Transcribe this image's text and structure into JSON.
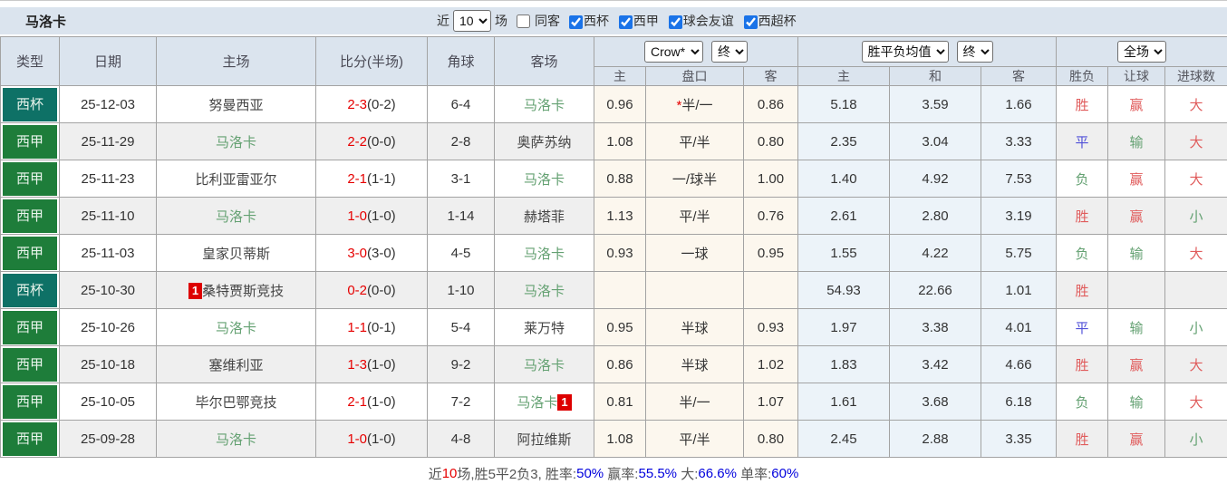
{
  "title": "马洛卡",
  "topbar": {
    "near_label": "近",
    "recent_count": "10",
    "matches_label": "场",
    "same_away": {
      "label": "同客",
      "checked": false
    },
    "filters": [
      {
        "label": "西杯",
        "checked": true
      },
      {
        "label": "西甲",
        "checked": true
      },
      {
        "label": "球会友谊",
        "checked": true
      },
      {
        "label": "西超杯",
        "checked": true
      }
    ]
  },
  "header": {
    "type": "类型",
    "date": "日期",
    "home": "主场",
    "score": "比分(半场)",
    "corner": "角球",
    "away": "客场",
    "odds_source_select": "Crow*",
    "odds_final_select": "终",
    "europe_avg_select": "胜平负均值",
    "europe_final_select": "终",
    "scope_select": "全场",
    "sub": {
      "h_home": "主",
      "h_line": "盘口",
      "h_away": "客",
      "e_win": "主",
      "e_draw": "和",
      "e_lose": "客",
      "r_result": "胜负",
      "r_handicap": "让球",
      "r_goals": "进球数"
    }
  },
  "rows": [
    {
      "type": "西杯",
      "type_color": "cup_badge",
      "date": "25-12-03",
      "home": "努曼西亚",
      "home_badge": "",
      "score": "2-3",
      "half": "(0-2)",
      "corner": "6-4",
      "away": "马洛卡",
      "away_badge": "",
      "star": "*",
      "odds_home": "0.96",
      "handicap": "半/一",
      "odds_away": "0.86",
      "win": "5.18",
      "draw": "3.59",
      "lose": "1.66",
      "result": "胜",
      "handicap_result": "赢",
      "goals_result": "大"
    },
    {
      "type": "西甲",
      "type_color": "league_badge",
      "date": "25-11-29",
      "home": "马洛卡",
      "home_badge": "",
      "score": "2-2",
      "half": "(0-0)",
      "corner": "2-8",
      "away": "奥萨苏纳",
      "away_badge": "",
      "star": "",
      "odds_home": "1.08",
      "handicap": "平/半",
      "odds_away": "0.80",
      "win": "2.35",
      "draw": "3.04",
      "lose": "3.33",
      "result": "平",
      "handicap_result": "输",
      "goals_result": "大"
    },
    {
      "type": "西甲",
      "type_color": "league_badge",
      "date": "25-11-23",
      "home": "比利亚雷亚尔",
      "home_badge": "",
      "score": "2-1",
      "half": "(1-1)",
      "corner": "3-1",
      "away": "马洛卡",
      "away_badge": "",
      "star": "",
      "odds_home": "0.88",
      "handicap": "一/球半",
      "odds_away": "1.00",
      "win": "1.40",
      "draw": "4.92",
      "lose": "7.53",
      "result": "负",
      "handicap_result": "赢",
      "goals_result": "大"
    },
    {
      "type": "西甲",
      "type_color": "league_badge",
      "date": "25-11-10",
      "home": "马洛卡",
      "home_badge": "",
      "score": "1-0",
      "half": "(1-0)",
      "corner": "1-14",
      "away": "赫塔菲",
      "away_badge": "",
      "star": "",
      "odds_home": "1.13",
      "handicap": "平/半",
      "odds_away": "0.76",
      "win": "2.61",
      "draw": "2.80",
      "lose": "3.19",
      "result": "胜",
      "handicap_result": "赢",
      "goals_result": "小"
    },
    {
      "type": "西甲",
      "type_color": "league_badge",
      "date": "25-11-03",
      "home": "皇家贝蒂斯",
      "home_badge": "",
      "score": "3-0",
      "half": "(3-0)",
      "corner": "4-5",
      "away": "马洛卡",
      "away_badge": "",
      "star": "",
      "odds_home": "0.93",
      "handicap": "一球",
      "odds_away": "0.95",
      "win": "1.55",
      "draw": "4.22",
      "lose": "5.75",
      "result": "负",
      "handicap_result": "输",
      "goals_result": "大"
    },
    {
      "type": "西杯",
      "type_color": "cup_badge",
      "date": "25-10-30",
      "home": "桑特贾斯竞技",
      "home_badge": "1",
      "score": "0-2",
      "half": "(0-0)",
      "corner": "1-10",
      "away": "马洛卡",
      "away_badge": "",
      "star": "",
      "odds_home": "",
      "handicap": "",
      "odds_away": "",
      "win": "54.93",
      "draw": "22.66",
      "lose": "1.01",
      "result": "胜",
      "handicap_result": "",
      "goals_result": ""
    },
    {
      "type": "西甲",
      "type_color": "league_badge",
      "date": "25-10-26",
      "home": "马洛卡",
      "home_badge": "",
      "score": "1-1",
      "half": "(0-1)",
      "corner": "5-4",
      "away": "莱万特",
      "away_badge": "",
      "star": "",
      "odds_home": "0.95",
      "handicap": "半球",
      "odds_away": "0.93",
      "win": "1.97",
      "draw": "3.38",
      "lose": "4.01",
      "result": "平",
      "handicap_result": "输",
      "goals_result": "小"
    },
    {
      "type": "西甲",
      "type_color": "league_badge",
      "date": "25-10-18",
      "home": "塞维利亚",
      "home_badge": "",
      "score": "1-3",
      "half": "(1-0)",
      "corner": "9-2",
      "away": "马洛卡",
      "away_badge": "",
      "star": "",
      "odds_home": "0.86",
      "handicap": "半球",
      "odds_away": "1.02",
      "win": "1.83",
      "draw": "3.42",
      "lose": "4.66",
      "result": "胜",
      "handicap_result": "赢",
      "goals_result": "大"
    },
    {
      "type": "西甲",
      "type_color": "league_badge",
      "date": "25-10-05",
      "home": "毕尔巴鄂竞技",
      "home_badge": "",
      "score": "2-1",
      "half": "(1-0)",
      "corner": "7-2",
      "away": "马洛卡",
      "away_badge": "1",
      "star": "",
      "odds_home": "0.81",
      "handicap": "半/一",
      "odds_away": "1.07",
      "win": "1.61",
      "draw": "3.68",
      "lose": "6.18",
      "result": "负",
      "handicap_result": "输",
      "goals_result": "大"
    },
    {
      "type": "西甲",
      "type_color": "league_badge",
      "date": "25-09-28",
      "home": "马洛卡",
      "home_badge": "",
      "score": "1-0",
      "half": "(1-0)",
      "corner": "4-8",
      "away": "阿拉维斯",
      "away_badge": "",
      "star": "",
      "odds_home": "1.08",
      "handicap": "平/半",
      "odds_away": "0.80",
      "win": "2.45",
      "draw": "2.88",
      "lose": "3.35",
      "result": "胜",
      "handicap_result": "赢",
      "goals_result": "小"
    }
  ],
  "result_colors": {
    "胜": "res_red",
    "平": "res_blue",
    "负": "res_green",
    "赢": "res_red",
    "输": "res_green",
    "大": "res_red",
    "小": "res_green"
  },
  "footer": {
    "segments": [
      {
        "t": "近",
        "c": "footer_label"
      },
      {
        "t": "10",
        "c": "footer_red"
      },
      {
        "t": "场,胜5平2负3, 胜率:",
        "c": "footer_label"
      },
      {
        "t": "50%",
        "c": "footer_blue"
      },
      {
        "t": " 赢率:",
        "c": "footer_label"
      },
      {
        "t": "55.5%",
        "c": "footer_blue"
      },
      {
        "t": " 大:",
        "c": "footer_label"
      },
      {
        "t": "66.6%",
        "c": "footer_blue"
      },
      {
        "t": " 单率:",
        "c": "footer_label"
      },
      {
        "t": "60%",
        "c": "footer_blue"
      }
    ]
  },
  "colors": {
    "header_bg": "#dbe4ee",
    "cup_badge": "#0e7166",
    "league_badge": "#1e7d3a",
    "subject_team": "#64a172",
    "score_red": "#e60000",
    "red_badge": "#dd0000",
    "res_red": "#e05c5c",
    "res_blue": "#5050d8",
    "res_green": "#64a172",
    "odds_bg": "#fcf7ee",
    "europe_bg": "#ecf3f9",
    "footer_label": "#555555",
    "footer_red": "#e60000",
    "footer_blue": "#0000dd",
    "checkbox_blue": "#1a73e8"
  }
}
